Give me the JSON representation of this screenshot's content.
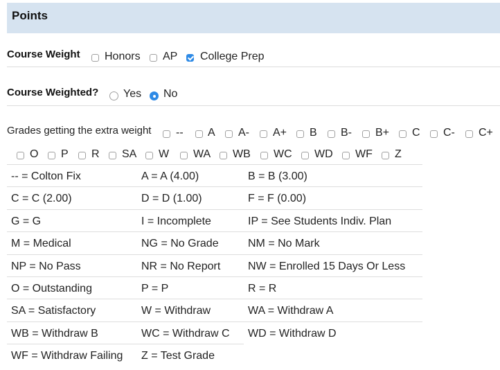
{
  "section": {
    "title": "Points"
  },
  "course_weight": {
    "label": "Course Weight",
    "options": [
      {
        "label": "Honors",
        "checked": false
      },
      {
        "label": "AP",
        "checked": false
      },
      {
        "label": "College Prep",
        "checked": true
      }
    ]
  },
  "course_weighted": {
    "label": "Course Weighted?",
    "options": [
      {
        "label": "Yes",
        "selected": false
      },
      {
        "label": "No",
        "selected": true
      }
    ]
  },
  "extra_weight": {
    "label": "Grades getting the extra weight",
    "grades": [
      "--",
      "A",
      "A-",
      "A+",
      "B",
      "B-",
      "B+",
      "C",
      "C-",
      "C+",
      "O",
      "P",
      "R",
      "SA",
      "W",
      "WA",
      "WB",
      "WC",
      "WD",
      "WF",
      "Z"
    ]
  },
  "legend": [
    [
      "-- = Colton Fix",
      "A = A (4.00)",
      "B = B (3.00)"
    ],
    [
      "C = C (2.00)",
      "D = D (1.00)",
      "F = F (0.00)"
    ],
    [
      "G = G",
      "I = Incomplete",
      "IP = See Students Indiv. Plan"
    ],
    [
      "M = Medical",
      "NG = No Grade",
      "NM = No Mark"
    ],
    [
      "NP = No Pass",
      "NR = No Report",
      "NW = Enrolled 15 Days Or Less"
    ],
    [
      "O = Outstanding",
      "P = P",
      "R = R"
    ],
    [
      "SA = Satisfactory",
      "W = Withdraw",
      "WA = Withdraw A"
    ],
    [
      "WB = Withdraw B",
      "WC = Withdraw C",
      "WD = Withdraw D"
    ],
    [
      "WF = Withdraw Failing",
      "Z = Test Grade",
      ""
    ]
  ]
}
